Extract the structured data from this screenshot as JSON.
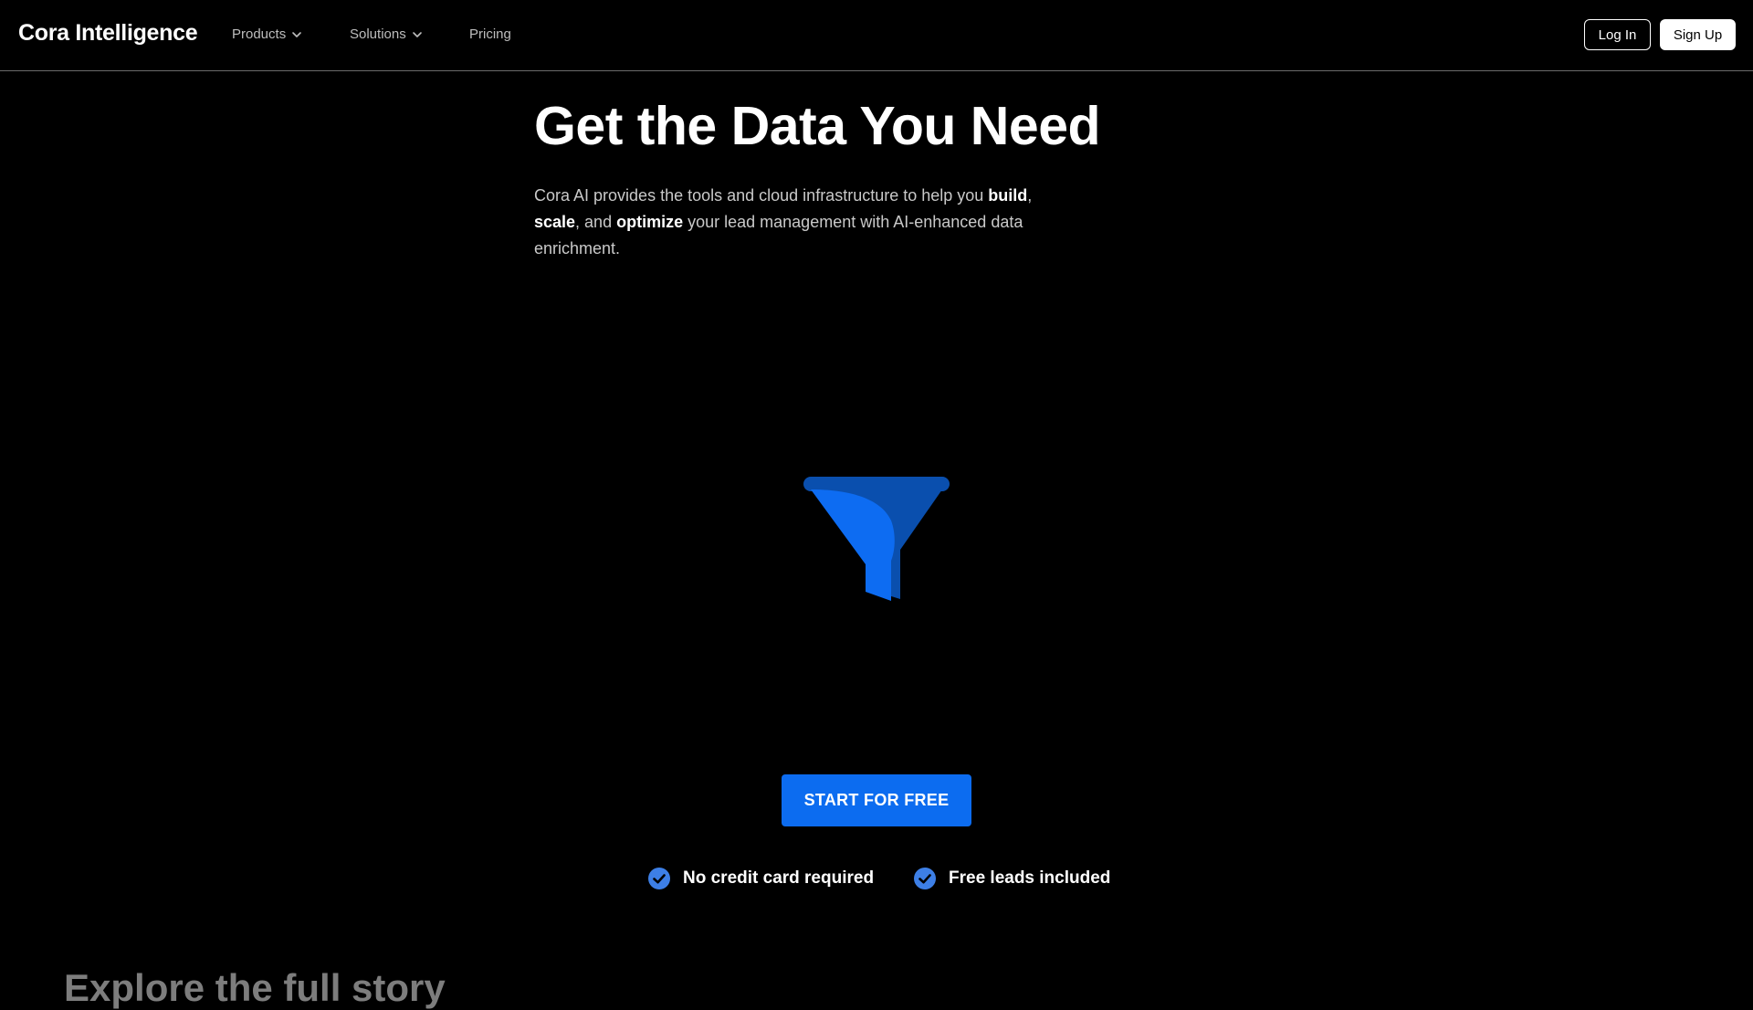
{
  "nav": {
    "brand": "Cora Intelligence",
    "products_label": "Products",
    "solutions_label": "Solutions",
    "pricing_label": "Pricing",
    "login_label": "Log In",
    "signup_label": "Sign Up"
  },
  "hero": {
    "title": "Get the Data You Need",
    "desc_part1": "Cora AI provides the tools and cloud infrastructure to help you ",
    "desc_bold1": "build",
    "desc_sep1": ", ",
    "desc_bold2": "scale",
    "desc_sep2": ", and ",
    "desc_bold3": "optimize",
    "desc_part2": " your lead management with AI-enhanced data enrichment.",
    "funnel_icon": "funnel-icon",
    "cta_label": "START FOR FREE"
  },
  "perks": [
    {
      "label": "No credit card required",
      "icon": "check-circle-icon"
    },
    {
      "label": "Free leads included",
      "icon": "check-circle-icon"
    }
  ],
  "next_section": {
    "title": "Explore the full story"
  },
  "colors": {
    "background": "#000000",
    "accent": "#0c6cf0",
    "funnel_dark": "#0a4fae",
    "funnel_light": "#0d6cf2",
    "check": "#3d7fe6"
  }
}
